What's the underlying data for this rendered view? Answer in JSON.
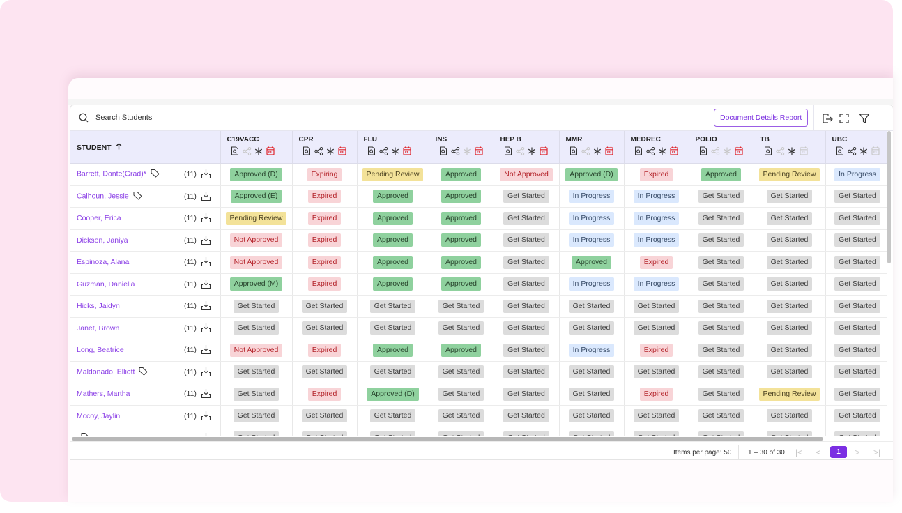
{
  "colors": {
    "background": "#fde4f1",
    "accent": "#7b2fe3",
    "link": "#8a3ee6",
    "header_bg": "#ececfc",
    "status": {
      "approved": "#8fd19e",
      "expired": "#f8d4d7",
      "pending": "#f3e299",
      "in_progress": "#dae8fd",
      "get_started": "#dcdcdc"
    }
  },
  "toolbar": {
    "search_placeholder": "Search Students",
    "report_button": "Document Details Report",
    "icons": [
      "export-icon",
      "fullscreen-icon",
      "filter-icon"
    ]
  },
  "table": {
    "student_header": "STUDENT",
    "sort_icon": "arrow-up-icon",
    "columns": [
      {
        "name": "C19VACC",
        "icons": {
          "doc": true,
          "share": false,
          "required": true,
          "calendar": true
        }
      },
      {
        "name": "CPR",
        "icons": {
          "doc": true,
          "share": true,
          "required": true,
          "calendar": true
        }
      },
      {
        "name": "FLU",
        "icons": {
          "doc": true,
          "share": true,
          "required": true,
          "calendar": true
        }
      },
      {
        "name": "INS",
        "icons": {
          "doc": true,
          "share": true,
          "required": false,
          "calendar": true
        }
      },
      {
        "name": "HEP B",
        "icons": {
          "doc": true,
          "share": false,
          "required": true,
          "calendar": true
        }
      },
      {
        "name": "MMR",
        "icons": {
          "doc": true,
          "share": false,
          "required": true,
          "calendar": true
        }
      },
      {
        "name": "MEDREC",
        "icons": {
          "doc": true,
          "share": true,
          "required": true,
          "calendar": true
        }
      },
      {
        "name": "POLIO",
        "icons": {
          "doc": true,
          "share": false,
          "required": false,
          "calendar": true
        }
      },
      {
        "name": "TB",
        "icons": {
          "doc": true,
          "share": false,
          "required": true,
          "calendar": false
        }
      },
      {
        "name": "UBC",
        "icons": {
          "doc": true,
          "share": true,
          "required": true,
          "calendar": false
        }
      }
    ],
    "rows": [
      {
        "name": "Barrett, Donte(Grad)*",
        "tag": true,
        "count": "(11)",
        "statuses": [
          "Approved (D)",
          "Expiring",
          "Pending Review",
          "Approved",
          "Not Approved",
          "Approved (D)",
          "Expired",
          "Approved",
          "Pending Review",
          "In Progress"
        ]
      },
      {
        "name": "Calhoun, Jessie",
        "tag": true,
        "count": "(11)",
        "statuses": [
          "Approved (E)",
          "Expired",
          "Approved",
          "Approved",
          "Get Started",
          "In Progress",
          "In Progress",
          "Get Started",
          "Get Started",
          "Get Started"
        ]
      },
      {
        "name": "Cooper, Erica",
        "tag": false,
        "count": "(11)",
        "statuses": [
          "Pending Review",
          "Expired",
          "Approved",
          "Approved",
          "Get Started",
          "In Progress",
          "In Progress",
          "Get Started",
          "Get Started",
          "Get Started"
        ]
      },
      {
        "name": "Dickson, Janiya",
        "tag": false,
        "count": "(11)",
        "statuses": [
          "Not Approved",
          "Expired",
          "Approved",
          "Approved",
          "Get Started",
          "In Progress",
          "In Progress",
          "Get Started",
          "Get Started",
          "Get Started"
        ]
      },
      {
        "name": "Espinoza, Alana",
        "tag": false,
        "count": "(11)",
        "statuses": [
          "Not Approved",
          "Expired",
          "Approved",
          "Approved",
          "Get Started",
          "Approved",
          "Expired",
          "Get Started",
          "Get Started",
          "Get Started"
        ]
      },
      {
        "name": "Guzman, Daniella",
        "tag": false,
        "count": "(11)",
        "statuses": [
          "Approved (M)",
          "Expired",
          "Approved",
          "Approved",
          "Get Started",
          "In Progress",
          "In Progress",
          "Get Started",
          "Get Started",
          "Get Started"
        ]
      },
      {
        "name": "Hicks, Jaidyn",
        "tag": false,
        "count": "(11)",
        "statuses": [
          "Get Started",
          "Get Started",
          "Get Started",
          "Get Started",
          "Get Started",
          "Get Started",
          "Get Started",
          "Get Started",
          "Get Started",
          "Get Started"
        ]
      },
      {
        "name": "Janet, Brown",
        "tag": false,
        "count": "(11)",
        "statuses": [
          "Get Started",
          "Get Started",
          "Get Started",
          "Get Started",
          "Get Started",
          "Get Started",
          "Get Started",
          "Get Started",
          "Get Started",
          "Get Started"
        ]
      },
      {
        "name": "Long, Beatrice",
        "tag": false,
        "count": "(11)",
        "statuses": [
          "Not Approved",
          "Expired",
          "Approved",
          "Approved",
          "Get Started",
          "In Progress",
          "Expired",
          "Get Started",
          "Get Started",
          "Get Started"
        ]
      },
      {
        "name": "Maldonado, Elliott",
        "tag": true,
        "count": "(11)",
        "statuses": [
          "Get Started",
          "Get Started",
          "Get Started",
          "Get Started",
          "Get Started",
          "Get Started",
          "Get Started",
          "Get Started",
          "Get Started",
          "Get Started"
        ]
      },
      {
        "name": "Mathers, Martha",
        "tag": false,
        "count": "(11)",
        "statuses": [
          "Get Started",
          "Expired",
          "Approved (D)",
          "Get Started",
          "Get Started",
          "Get Started",
          "Expired",
          "Get Started",
          "Pending Review",
          "Get Started"
        ]
      },
      {
        "name": "Mccoy, Jaylin",
        "tag": false,
        "count": "(11)",
        "statuses": [
          "Get Started",
          "Get Started",
          "Get Started",
          "Get Started",
          "Get Started",
          "Get Started",
          "Get Started",
          "Get Started",
          "Get Started",
          "Get Started"
        ]
      },
      {
        "name": "",
        "tag": true,
        "count": "",
        "statuses": [
          "Get Started",
          "Get Started",
          "Get Started",
          "Get Started",
          "Get Started",
          "Get Started",
          "Get Started",
          "Get Started",
          "Get Started",
          "Get Started"
        ]
      }
    ]
  },
  "pagination": {
    "items_per_page_label": "Items per page: 50",
    "range_label": "1 – 30 of 30",
    "current_page": "1"
  }
}
